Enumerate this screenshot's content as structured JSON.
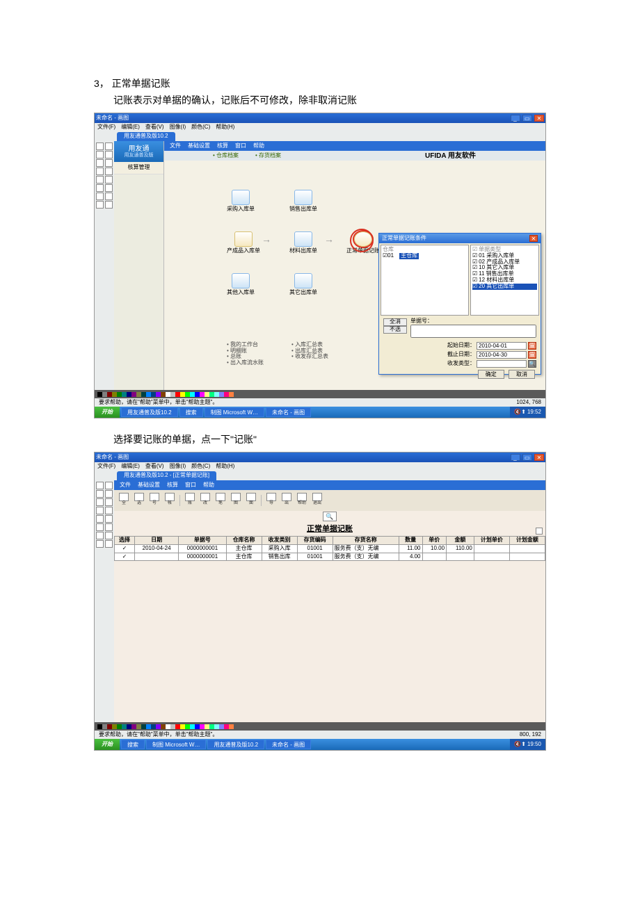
{
  "doc": {
    "heading": "3， 正常单据记账",
    "subtext": "记账表示对单据的确认，记账后不可修改，除非取消记账",
    "para2": "选择要记账的单据，点一下\"记账\""
  },
  "s1": {
    "window_title": "未命名 - 画图",
    "menus": [
      "文件(F)",
      "编辑(E)",
      "查看(V)",
      "图像(I)",
      "颜色(C)",
      "帮助(H)"
    ],
    "app_tab": "用友通普及版10.2",
    "submenu": [
      "文件",
      "基础设置",
      "核算",
      "窗口",
      "帮助"
    ],
    "toolbar2": [
      "• 仓库档案",
      "• 存货档案"
    ],
    "brand": "UFIDA 用友软件",
    "sidebar_brand": "用友通",
    "sidebar_brand_sub": "用友通普及版",
    "sidebar_item": "核算管理",
    "nodes": {
      "n1": "采购入库单",
      "n2": "销售出库单",
      "n3": "产成品入库单",
      "n4": "材料出库单",
      "n5": "正常单据记账",
      "n6": "其他入库单",
      "n7": "其它出库单"
    },
    "links": [
      "我的工作台",
      "明细账",
      "总账",
      "出入库流水账",
      "入库汇总表",
      "出库汇总表",
      "收发存汇总表"
    ],
    "dialog": {
      "title": "正常单据记账条件",
      "left_hdr": "仓库",
      "col1": "01",
      "col2": "主仓库",
      "right_hdr": "单据类型",
      "types": [
        [
          "01",
          "采购入库单"
        ],
        [
          "02",
          "产成品入库单"
        ],
        [
          "10",
          "其它入库单"
        ],
        [
          "11",
          "销售出库单"
        ],
        [
          "12",
          "材料出库单"
        ],
        [
          "20",
          "其它出库单"
        ]
      ],
      "sel_idx": 5,
      "btn_all": "全消",
      "btn_none": "不选",
      "lbl_no": "单据号：",
      "lbl_start": "起始日期：",
      "val_start": "2010-04-01",
      "lbl_end": "截止日期：",
      "val_end": "2010-04-30",
      "lbl_ctype": "收发类型：",
      "ok": "确定",
      "cancel": "取消"
    },
    "status": "要求帮助，请在\"帮助\"菜单中，单击\"帮助主题\"。",
    "status_right": "1024, 768",
    "taskbar": {
      "start": "开始",
      "items": [
        "",
        "用友通普及版10.2",
        "搜索",
        "",
        "制图 Microsoft W…",
        "未命名 - 画图"
      ],
      "time": "19:52"
    }
  },
  "s2": {
    "window_title": "未命名 - 画图",
    "menus": [
      "文件(F)",
      "编辑(E)",
      "查看(V)",
      "图像(I)",
      "颜色(C)",
      "帮助(H)"
    ],
    "app_tab": "用友通普及版10.2 - [正常单据记账]",
    "submenu": [
      "文件",
      "基础设置",
      "核算",
      "窗口",
      "帮助"
    ],
    "tool_icons": [
      "全",
      "选",
      "号",
      "帐",
      "账",
      "改",
      "笔",
      "图",
      "面",
      "导",
      "出",
      "帮助",
      "退出"
    ],
    "search_icon": "🔍",
    "grid_title": "正常单据记账",
    "columns": [
      "选择",
      "日期",
      "单据号",
      "仓库名称",
      "收发类别",
      "存货编码",
      "存货名称",
      "数量",
      "单价",
      "金额",
      "计划单价",
      "计划金额"
    ],
    "rows": [
      {
        "sel": "✓",
        "date": "2010-04-24",
        "no": "0000000001",
        "wh": "主仓库",
        "cat": "采购入库",
        "code": "01001",
        "name": "服务费（支）无编",
        "qty": "11.00",
        "price": "10.00",
        "amt": "110.00",
        "pp": "",
        "pa": ""
      },
      {
        "sel": "✓",
        "date": "",
        "no": "0000000001",
        "wh": "主仓库",
        "cat": "销售出库",
        "code": "01001",
        "name": "服务费（支）无编",
        "qty": "4.00",
        "price": "",
        "amt": "",
        "pp": "",
        "pa": ""
      }
    ],
    "status": "要求帮助，请在\"帮助\"菜单中，单击\"帮助主题\"。",
    "status_right": "800, 192",
    "taskbar": {
      "start": "开始",
      "items": [
        "",
        "搜索",
        "",
        "制图 Microsoft W…",
        "用友通普及版10.2",
        "未命名 - 画图"
      ],
      "time": "19:50"
    }
  },
  "palette": [
    "#000",
    "#808080",
    "#800000",
    "#808000",
    "#008000",
    "#008080",
    "#000080",
    "#800080",
    "#808040",
    "#004040",
    "#0080ff",
    "#004080",
    "#8000ff",
    "#804000",
    "#fff",
    "#c0c0c0",
    "#ff0000",
    "#ffff00",
    "#00ff00",
    "#00ffff",
    "#0000ff",
    "#ff00ff",
    "#ffff80",
    "#00ff80",
    "#80ffff",
    "#8080ff",
    "#ff0080",
    "#ff8040"
  ]
}
